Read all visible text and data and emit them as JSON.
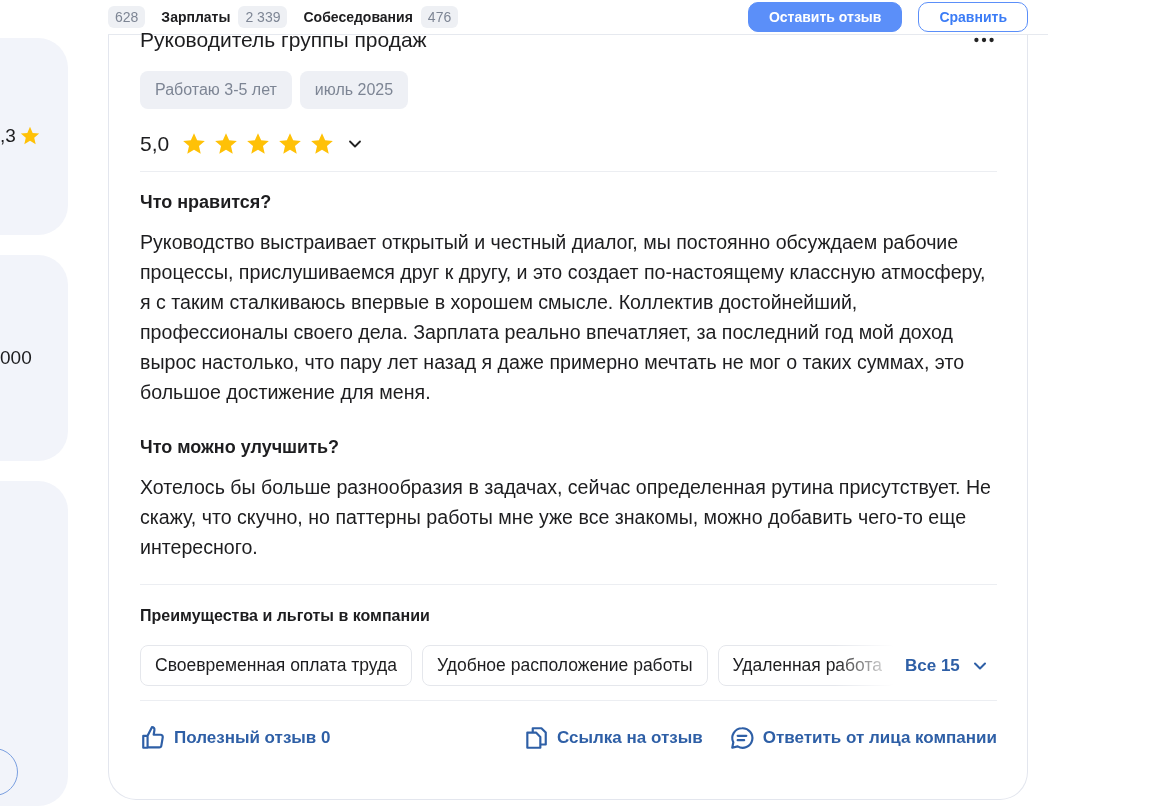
{
  "top_bar": {
    "stats": [
      {
        "count": "628"
      },
      {
        "label": "Зарплаты",
        "count": "2 339"
      },
      {
        "label": "Собеседования",
        "count": "476"
      }
    ],
    "buttons": [
      {
        "label": "Оставить отзыв",
        "kind": "primary"
      },
      {
        "label": "Сравнить",
        "kind": "outline"
      }
    ]
  },
  "sidebar": {
    "cards": [
      {
        "text": ",3",
        "kind": "rating"
      },
      {
        "text": "000",
        "kind": "plain"
      },
      {
        "kind": "button"
      }
    ]
  },
  "review": {
    "title": "Руководитель группы продаж",
    "tags": [
      "Работаю 3-5 лет",
      "июль 2025"
    ],
    "rating": "5,0",
    "stars": 5,
    "sections": [
      {
        "heading": "Что нравится?",
        "text": "Руководство выстраивает открытый и честный диалог, мы постоянно обсуждаем рабочие процессы, прислушиваемся друг к другу, и это создает по-настоящему классную атмосферу, я с таким сталкиваюсь впервые в хорошем смысле. Коллектив достойнейший, профессионалы своего дела. Зарплата реально впечатляет, за последний год мой доход вырос настолько, что пару лет назад я даже примерно мечтать не мог о таких суммах, это большое достижение для меня."
      },
      {
        "heading": "Что можно улучшить?",
        "text": "Хотелось бы больше разнообразия в задачах, сейчас определенная рутина присутствует. Не скажу, что скучно, но паттерны работы мне уже все знакомы, можно добавить чего-то еще интересного."
      }
    ],
    "benefits": {
      "heading": "Преимущества и льготы в компании",
      "items": [
        "Своевременная оплата труда",
        "Удобное расположение работы",
        "Удаленная работа"
      ],
      "more": "Все 15"
    },
    "actions": [
      {
        "label": "Полезный отзыв 0",
        "kind": "like"
      },
      {
        "label": "Ссылка на отзыв",
        "kind": "copy"
      },
      {
        "label": "Ответить от лица компании",
        "kind": "reply"
      }
    ]
  }
}
